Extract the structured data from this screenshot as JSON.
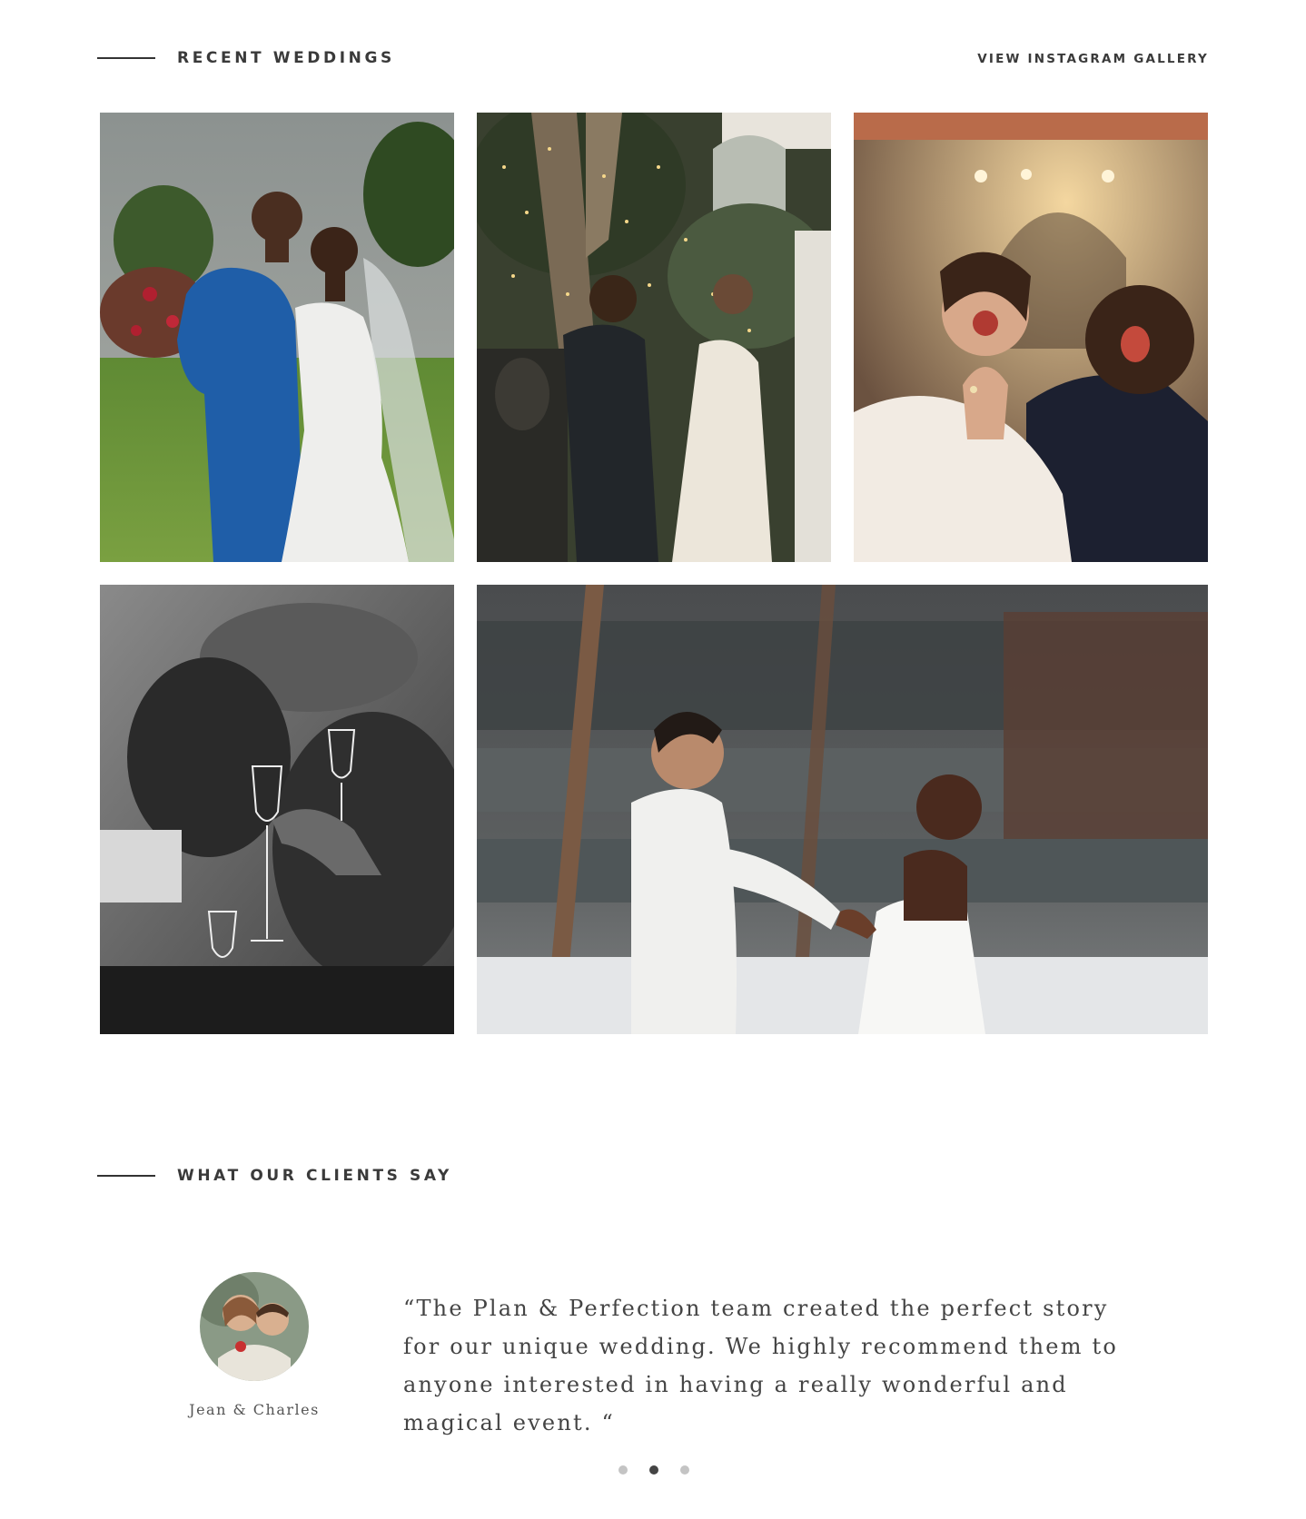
{
  "recent_weddings": {
    "title": "RECENT WEDDINGS",
    "gallery_link": "VIEW INSTAGRAM GALLERY"
  },
  "photos": [
    {
      "subject": "couple in blue suit and lace gown on lawn"
    },
    {
      "subject": "couple celebrating under string-light tree"
    },
    {
      "subject": "bride showing ring, groom laughing"
    },
    {
      "subject": "black and white champagne toast"
    },
    {
      "subject": "couple holding hands in snow"
    }
  ],
  "testimonials": {
    "title": "WHAT OUR CLIENTS SAY",
    "client_name": "Jean & Charles",
    "quote": "“The Plan & Perfection team created the perfect story for our unique wedding. We highly recommend them to anyone interested in having a really wonderful and magical event. “",
    "slide_count": 3,
    "active_slide": 2
  },
  "colors": {
    "text": "#333333",
    "dot_active": "#444444",
    "dot_inactive": "#c4c4c4"
  }
}
